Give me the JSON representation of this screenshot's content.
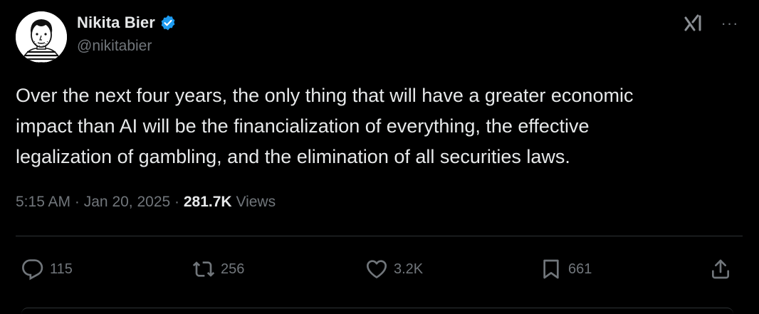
{
  "author": {
    "display_name": "Nikita Bier",
    "handle": "@nikitabier",
    "verified": true,
    "avatar": "sketch-portrait-avatar"
  },
  "header_icons": {
    "grok": "grok-icon",
    "more": "more-horizontal-icon",
    "more_glyph": "···"
  },
  "tweet": {
    "lines": [
      "Over the next four years, the only thing that will have a greater economic",
      "impact than AI will be the financialization of everything, the effective",
      "legalization of gambling, and the elimination of all securities laws."
    ]
  },
  "meta": {
    "time": "5:15 AM",
    "sep1": "·",
    "date": "Jan 20, 2025",
    "sep2": "·",
    "views_count": "281.7K",
    "views_label": "Views"
  },
  "actions": {
    "reply_count": "115",
    "retweet_count": "256",
    "like_count": "3.2K",
    "bookmark_count": "661"
  },
  "colors": {
    "background": "#000000",
    "text_primary": "#e7e9ea",
    "text_secondary": "#71767b",
    "divider": "#2f3336",
    "verified_badge": "#1d9bf0"
  }
}
